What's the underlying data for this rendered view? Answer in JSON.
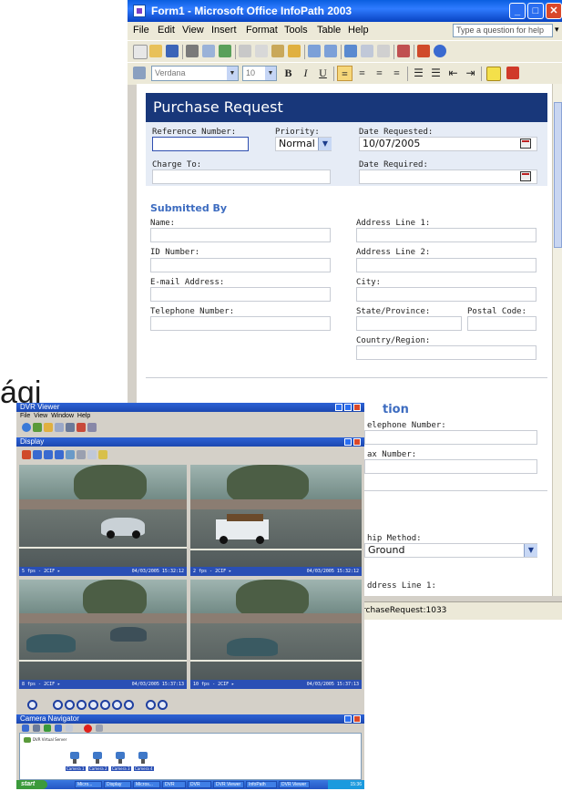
{
  "slide": {
    "partial_word": "ági"
  },
  "infopath": {
    "title": "Form1 - Microsoft Office InfoPath 2003",
    "menu": [
      "File",
      "Edit",
      "View",
      "Insert",
      "Format",
      "Tools",
      "Table",
      "Help"
    ],
    "help_placeholder": "Type a question for help",
    "font_name": "Verdana",
    "font_size": "10",
    "format_buttons": [
      "B",
      "I",
      "U"
    ],
    "form": {
      "title": "Purchase Request",
      "reference_number_label": "Reference Number:",
      "reference_number_value": "",
      "priority_label": "Priority:",
      "priority_value": "Normal",
      "date_requested_label": "Date Requested:",
      "date_requested_value": "10/07/2005",
      "charge_to_label": "Charge To:",
      "date_required_label": "Date Required:",
      "submitted_by": {
        "heading": "Submitted By",
        "name_label": "Name:",
        "id_label": "ID Number:",
        "email_label": "E-mail Address:",
        "phone_label": "Telephone Number:",
        "addr1_label": "Address Line 1:",
        "addr2_label": "Address Line 2:",
        "city_label": "City:",
        "state_label": "State/Province:",
        "postal_label": "Postal Code:",
        "country_label": "Country/Region:"
      },
      "supplier": {
        "heading_visible": "tion",
        "phone_label_partial": "elephone Number:",
        "fax_label_partial": "ax Number:",
        "ship_method_label_partial": "hip Method:",
        "ship_method_value_partial": "Ground",
        "addr1_label_partial": "ddress Line 1:"
      }
    },
    "status_text_partial": "rchaseRequest:1033"
  },
  "dvr": {
    "title": "DVR Viewer",
    "menu": [
      "File",
      "View",
      "Window",
      "Help"
    ],
    "display_title": "Display",
    "feeds": [
      {
        "caption_left": "5 fps - 2CIF ▸",
        "caption_right": "04/03/2005 15:32:12"
      },
      {
        "caption_left": "2 fps - 2CIF ▸",
        "caption_right": "04/03/2005 15:32:12"
      },
      {
        "caption_left": "8 fps - 2CIF ▸",
        "caption_right": "04/03/2005 15:37:13"
      },
      {
        "caption_left": "10 fps - 2CIF ▸",
        "caption_right": "04/03/2005 15:37:13"
      }
    ],
    "navigator_title": "Camera Navigator",
    "server_label": "DVR Virtual Server",
    "camera_labels": [
      "Camera 1",
      "Camera 2",
      "Camera 3",
      "Camera 4"
    ],
    "taskbar": {
      "start": "start",
      "tasks": [
        "Micro...",
        "Display",
        "Micros...",
        "DVR",
        "DVR",
        "DVR Viewer",
        "InfoPath",
        "DVR Viewer"
      ],
      "clock": "15:36"
    }
  }
}
